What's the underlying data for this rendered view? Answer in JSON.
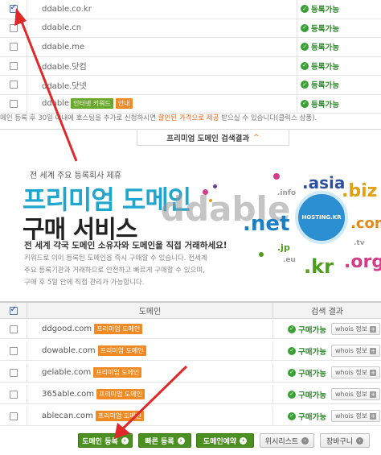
{
  "top_rows": [
    {
      "domain": "ddable.co.kr",
      "status": "등록가능",
      "checked": true
    },
    {
      "domain": "ddable.cn",
      "status": "등록가능",
      "checked": false
    },
    {
      "domain": "ddable.me",
      "status": "등록가능",
      "checked": false
    },
    {
      "domain": "ddable.닷컴",
      "status": "등록가능",
      "checked": false
    },
    {
      "domain": "ddable.닷넷",
      "status": "등록가능",
      "checked": false
    },
    {
      "domain": "ddable",
      "tag1": "인터넷 키워드",
      "tag2": "안내",
      "status": "등록가능",
      "checked": false
    }
  ],
  "notice": {
    "pre": "메인 등록 후 30일 이내에 호스팅을 추가로 신청하시면 ",
    "highlight": "할인된 가격으로 제공",
    "post": " 받으실 수 있습니다(클릭스 상품)."
  },
  "premium_tab": {
    "label": "프리미엄 도메인 검색결과",
    "chevron": "^"
  },
  "banner": {
    "small": "전 세계 주요 등록회사 제휴",
    "title1": "프리미엄 도메인",
    "title2": "구매 서비스",
    "watermark": "ddable",
    "headline": "전 세계 각국 도메인 소유자와 도메인을 직접 거래하세요!",
    "desc": "키워드로 이미 등록된 도메인을 즉시 구매할 수 있습니다. 전세계 주요 등록기관과 거래하므로 안전하고 빠르게 구매할 수 있으며, 구매 후 5일 안에 직접 관리가 가능합니다.",
    "globe_text": "HOSTING.KR",
    "tlds": [
      ".asia",
      ".biz",
      ".net",
      ".com",
      ".kr",
      ".org",
      ".jp",
      ".eu",
      ".info",
      ".tv"
    ],
    "colors": {
      "accent": "#1fa6cf",
      "net": "#1c7fc4",
      "asia": "#2c4fa0",
      "biz": "#e3a012",
      "kr": "#4f9d1d",
      "org": "#d43b8a",
      "com": "#e08a18"
    }
  },
  "bottom_table": {
    "header_domain": "도메인",
    "header_result": "검색 결과",
    "rows": [
      {
        "domain": "ddgood.com",
        "tag": "프리미엄 도메인",
        "status": "구매가능",
        "whois": "whois 정보"
      },
      {
        "domain": "dowable.com",
        "tag": "프리미엄 도메인",
        "status": "구매가능",
        "whois": "whois 정보"
      },
      {
        "domain": "gelable.com",
        "tag": "프리미엄 도메인",
        "status": "구매가능",
        "whois": "whois 정보"
      },
      {
        "domain": "365able.com",
        "tag": "프리미엄 도메인",
        "status": "구매가능",
        "whois": "whois 정보"
      },
      {
        "domain": "ablecan.com",
        "tag": "프리미엄 도메인",
        "status": "구매가능",
        "whois": "whois 정보"
      }
    ]
  },
  "buttons": {
    "register": "도메인 등록",
    "fast_register": "빠른 등록",
    "reserve": "도메인예약",
    "wishlist": "위시리스트",
    "cart": "장바구니"
  }
}
